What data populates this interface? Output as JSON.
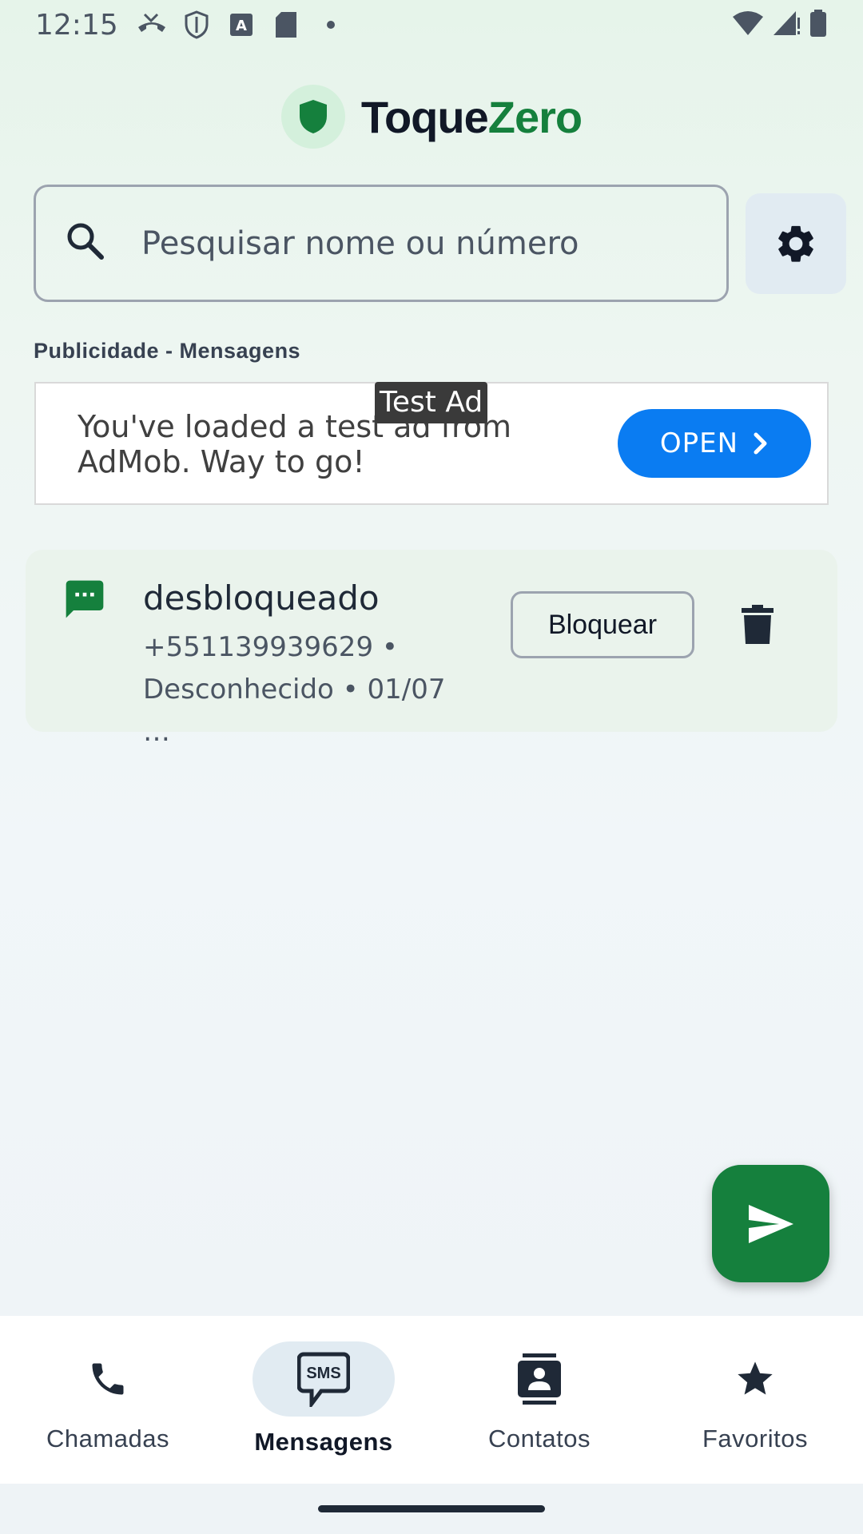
{
  "status_bar": {
    "time": "12:15",
    "left_icons": [
      "missed-call-icon",
      "shield-icon",
      "a-notification-icon",
      "sd-card-icon",
      "dot-icon"
    ],
    "right_icons": [
      "wifi-icon",
      "signal-icon",
      "battery-icon"
    ]
  },
  "header": {
    "brand_part1": "Toque",
    "brand_part2": "Zero",
    "logo_icon": "shield-icon"
  },
  "search": {
    "placeholder": "Pesquisar nome ou número",
    "value": ""
  },
  "ad": {
    "section_label": "Publicidade - Mensagens",
    "tag": "Test Ad",
    "text": "You've loaded a test ad from AdMob. Way to go!",
    "button_label": "OPEN"
  },
  "messages": [
    {
      "name": "desbloqueado",
      "detail": "+551139939629 • Desconhecido • 01/07 …",
      "block_label": "Bloquear"
    }
  ],
  "bottom_nav": {
    "items": [
      {
        "label": "Chamadas",
        "icon": "phone-icon",
        "active": false
      },
      {
        "label": "Mensagens",
        "icon": "sms-icon",
        "active": true
      },
      {
        "label": "Contatos",
        "icon": "contact-card-icon",
        "active": false
      },
      {
        "label": "Favoritos",
        "icon": "star-icon",
        "active": false
      }
    ]
  },
  "colors": {
    "brand_green": "#15803d",
    "ad_button_blue": "#0a7cf2",
    "active_nav_bg": "#e1ebf2"
  }
}
